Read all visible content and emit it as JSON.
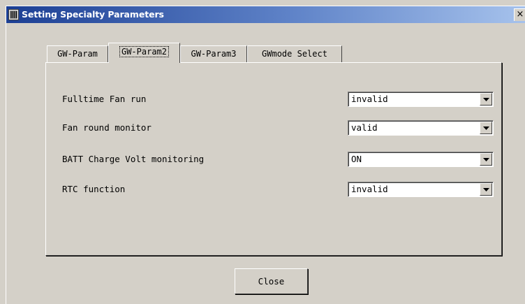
{
  "window": {
    "title": "Setting Specialty Parameters",
    "close_glyph": "×"
  },
  "tabs": [
    {
      "label": "GW-Param",
      "active": false
    },
    {
      "label": "GW-Param2",
      "active": true
    },
    {
      "label": "GW-Param3",
      "active": false
    },
    {
      "label": "GWmode Select",
      "active": false
    }
  ],
  "params": [
    {
      "label": "Fulltime Fan run",
      "value": "invalid"
    },
    {
      "label": "Fan round monitor",
      "value": "valid"
    },
    {
      "label": "BATT Charge Volt monitoring",
      "value": "ON"
    },
    {
      "label": "RTC function",
      "value": "invalid"
    }
  ],
  "footer": {
    "close_label": "Close"
  },
  "icons": {
    "app": "app-icon",
    "window_close": "close-icon",
    "dropdown": "dropdown-arrow-icon"
  },
  "colors": {
    "titlebar_start": "#1c3f94",
    "titlebar_end": "#a6c2ec",
    "face": "#d4d0c8"
  }
}
